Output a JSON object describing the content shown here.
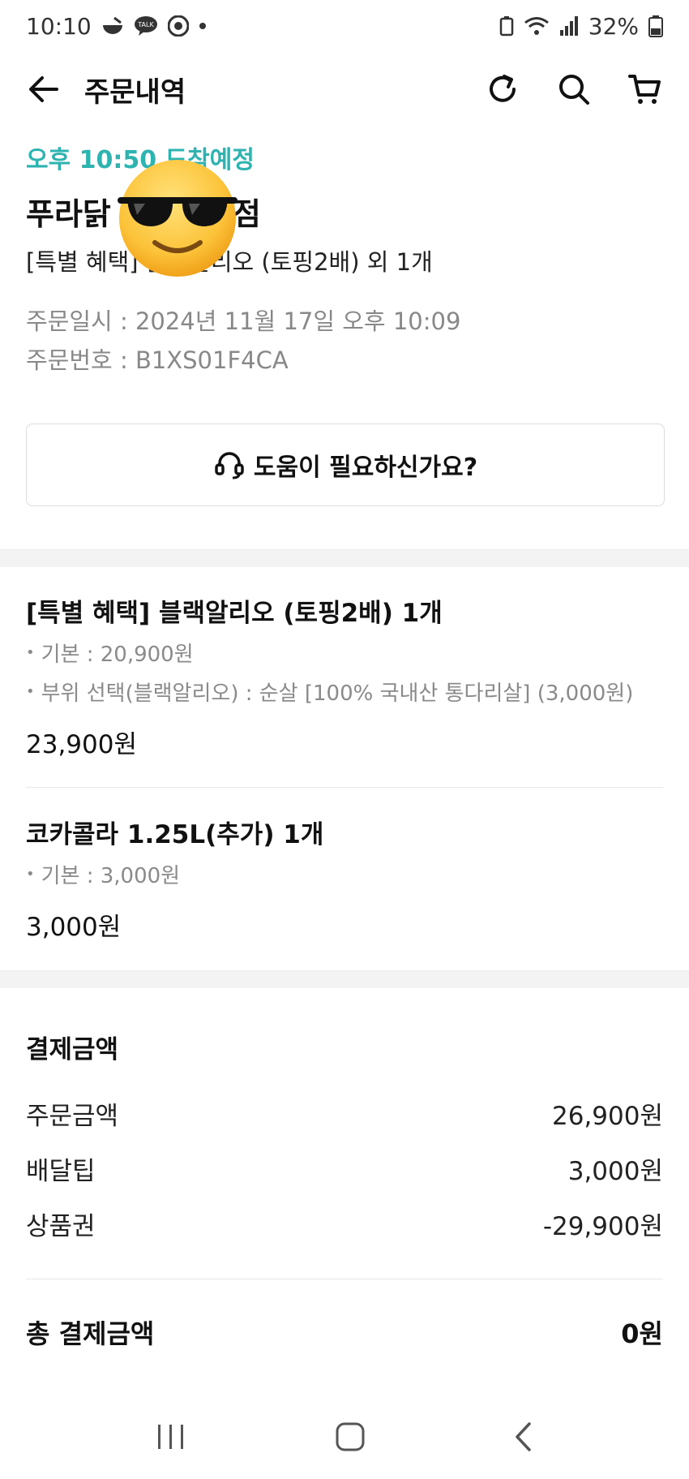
{
  "status_bar": {
    "time": "10:10",
    "battery": "32%"
  },
  "app_bar": {
    "title": "주문내역"
  },
  "order": {
    "eta": "오후 10:50 도착예정",
    "store_name_start": "푸라닭",
    "store_name_end": "점",
    "summary": "[특별 혜택] 블랙알리오 (토핑2배) 외 1개",
    "order_time_label": "주문일시 : ",
    "order_time": "2024년 11월 17일 오후 10:09",
    "order_no_label": "주문번호 : ",
    "order_no": "B1XS01F4CA"
  },
  "help": {
    "label": "도움이 필요하신가요?"
  },
  "items": [
    {
      "name": "[특별 혜택] 블랙알리오 (토핑2배) 1개",
      "options": [
        "기본 : 20,900원",
        "부위 선택(블랙알리오) : 순살 [100% 국내산 통다리살] (3,000원)"
      ],
      "price": "23,900원"
    },
    {
      "name": "코카콜라 1.25L(추가) 1개",
      "options": [
        "기본 : 3,000원"
      ],
      "price": "3,000원"
    }
  ],
  "payment": {
    "title": "결제금액",
    "rows": [
      {
        "label": "주문금액",
        "value": "26,900원"
      },
      {
        "label": "배달팁",
        "value": "3,000원"
      },
      {
        "label": "상품권",
        "value": "-29,900원"
      }
    ],
    "total_label": "총 결제금액",
    "total_value": "0원"
  },
  "colors": {
    "accent": "#2fb3b0",
    "muted": "#8a8a8a",
    "band": "#f3f3f4"
  }
}
